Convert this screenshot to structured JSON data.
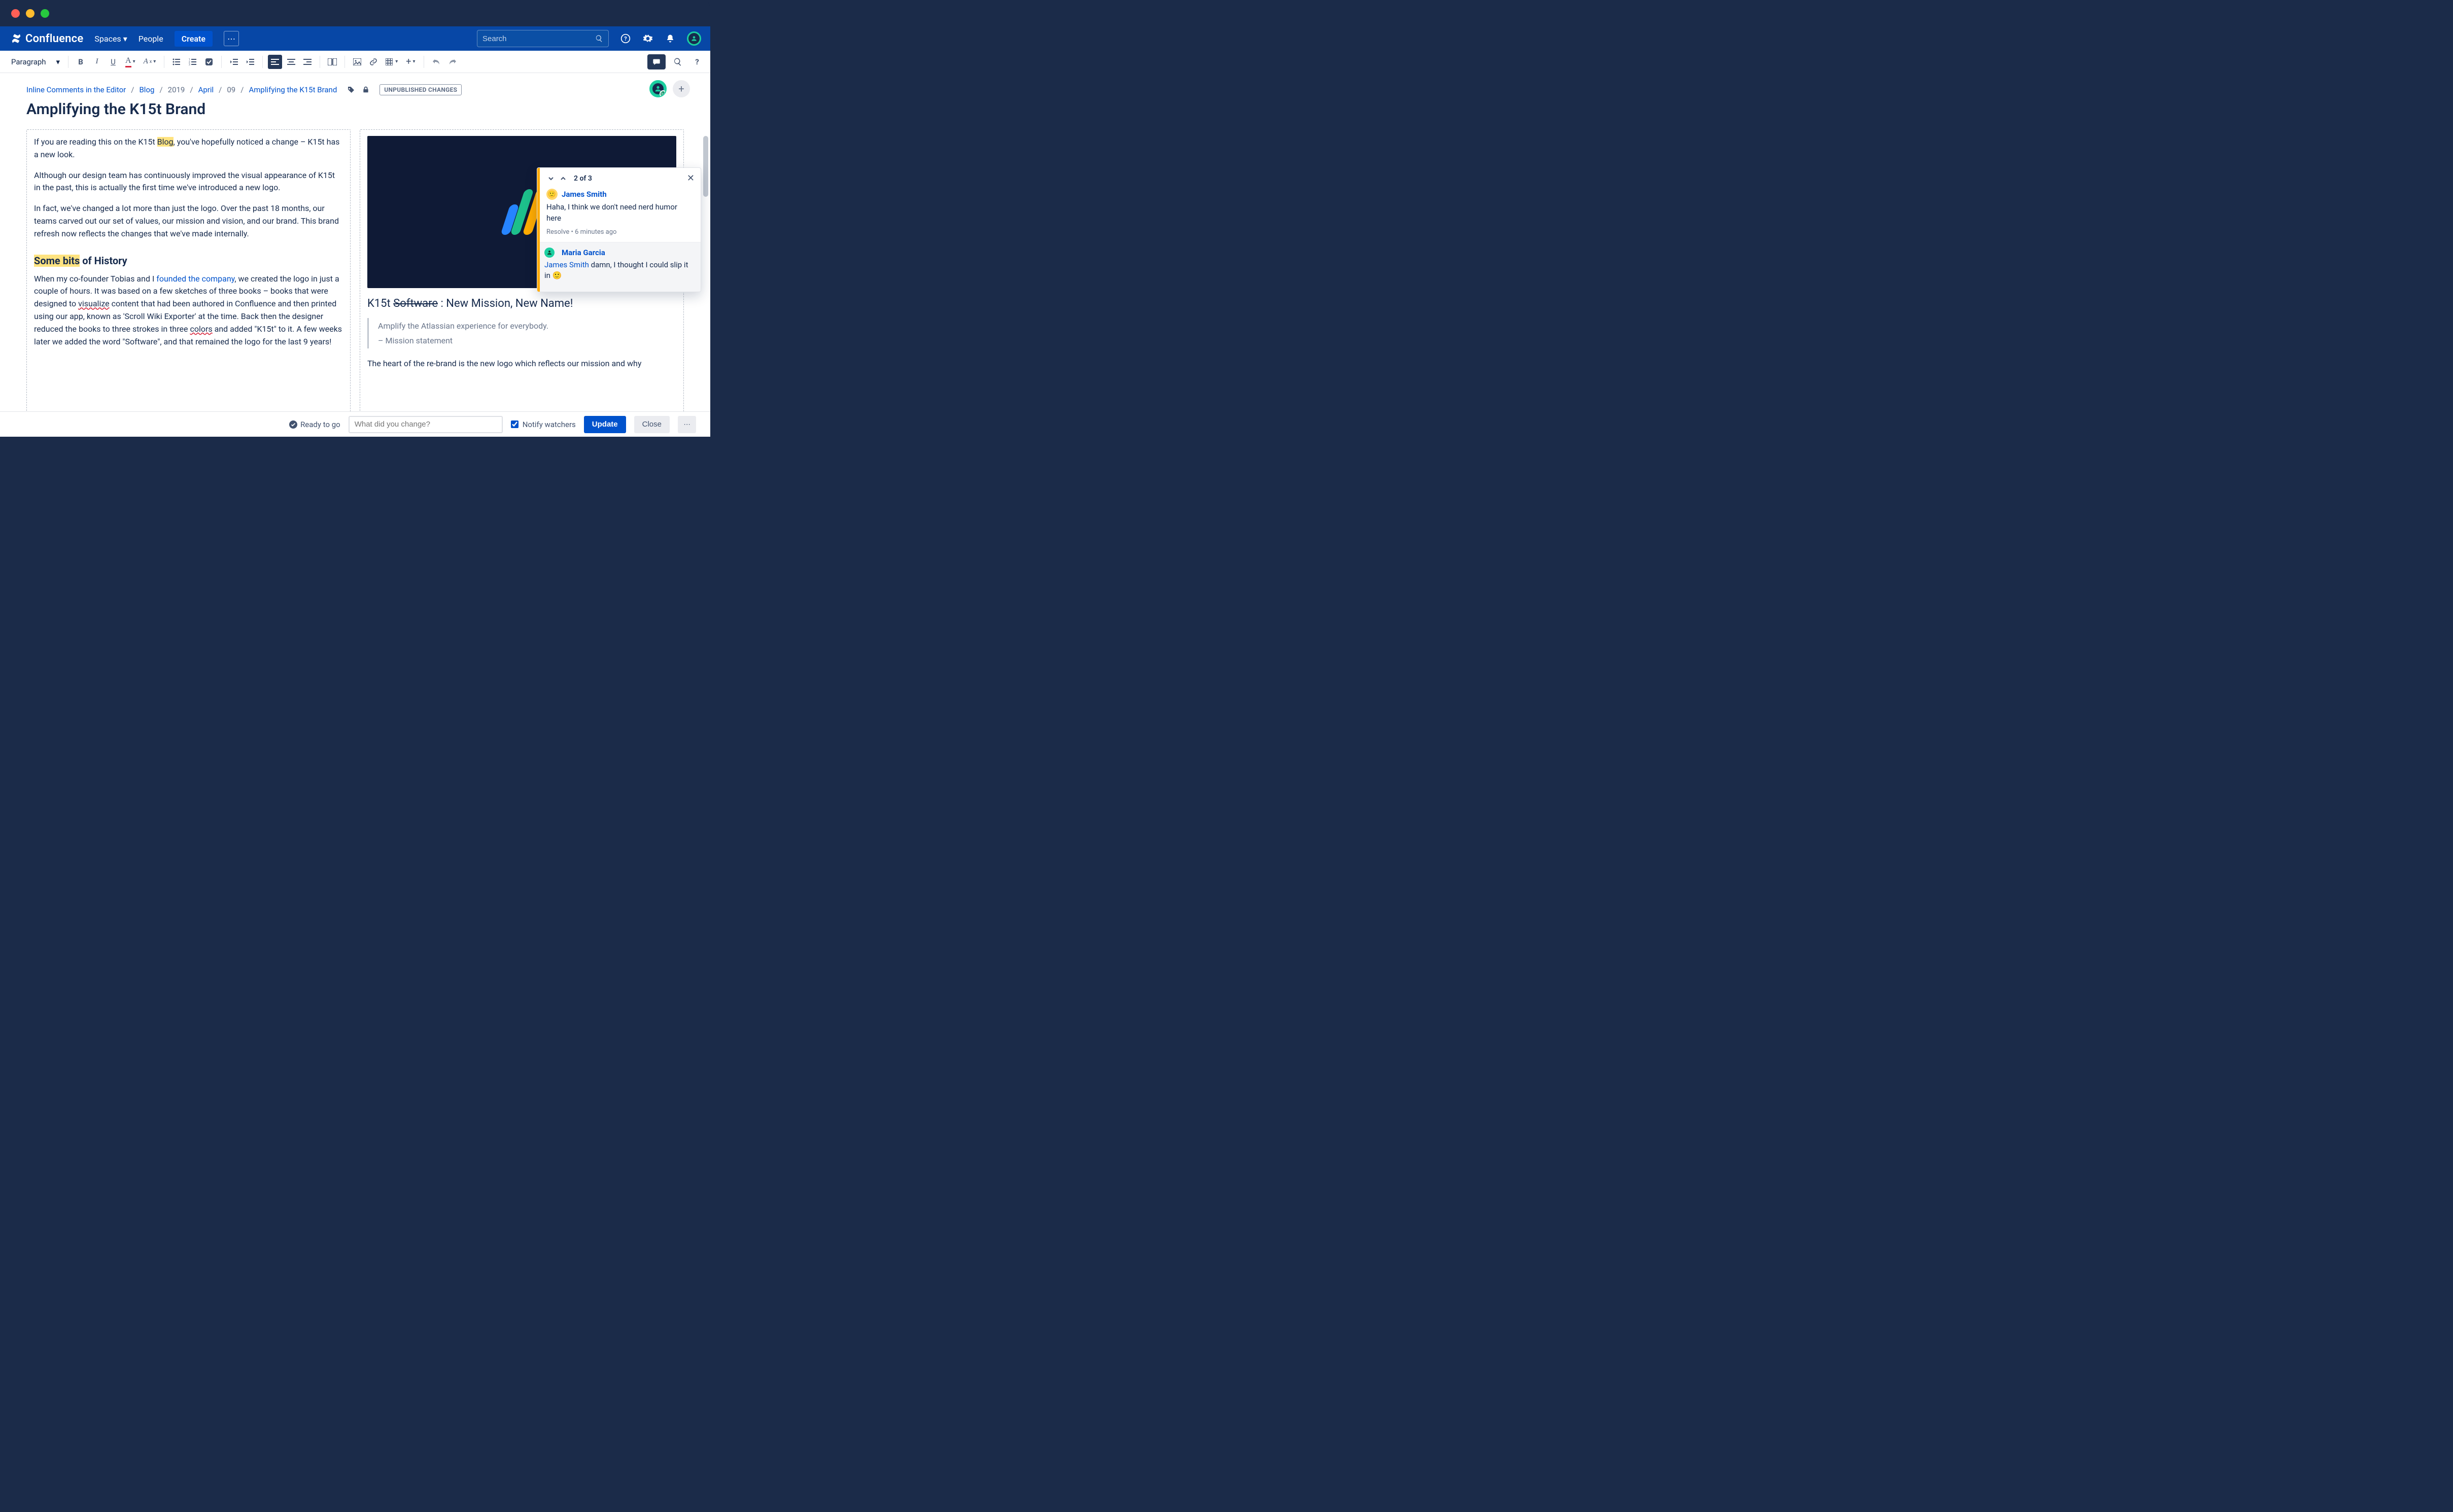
{
  "nav": {
    "product": "Confluence",
    "spaces": "Spaces",
    "people": "People",
    "create": "Create",
    "search_placeholder": "Search"
  },
  "toolbar": {
    "style_label": "Paragraph"
  },
  "breadcrumb": {
    "root": "Inline Comments in the Editor",
    "blog": "Blog",
    "year": "2019",
    "month": "April",
    "day": "09",
    "page": "Amplifying the K15t Brand",
    "badge": "UNPUBLISHED CHANGES"
  },
  "title": "Amplifying the K15t Brand",
  "left": {
    "p1a": "If you are reading this on the K15t ",
    "hl1": "Blog",
    "p1b": ", you've hopefully noticed a change – K15t has a new look.",
    "p2": "Although our design team has continuously improved the visual appearance of K15t in the past, this is actually the first time we've introduced a new logo.",
    "p3": "In fact, we've changed a lot more than just the logo. Over the past 18 months, our teams carved out our set of values, our mission and vision, and our brand. This brand refresh now reflects the changes that we've made internally.",
    "h2_hl": "Some bits",
    "h2_rest": " of History",
    "p4a": "When my co-founder Tobias and I ",
    "link": "founded the company",
    "p4b": ", we created the logo in just a couple of hours. It was based on a few sketches of three books – books that were designed to ",
    "sp1": "visualize",
    "p4c": " content that had been authored in Confluence and then printed using our app, known as 'Scroll Wiki Exporter' at the time. Back then the designer reduced the books to three strokes in three ",
    "sp2": "colors",
    "p4d": " and added \"K15t\" to it. A few weeks later we added the word \"Software\", and that remained the logo for the last 9 years!"
  },
  "right": {
    "h_pre": "K15t ",
    "h_strike": "Software",
    "h_post": " : New Mission, New Name!",
    "q1": "Amplify the Atlassian experience for everybody.",
    "q2": "– Mission statement",
    "p": "The heart of the re-brand is the new logo which reflects our mission and why"
  },
  "comments": {
    "count": "2 of 3",
    "c1_author": "James Smith",
    "c1_text": "Haha, I think we don't need nerd humor here",
    "c1_resolve": "Resolve",
    "c1_time": "6 minutes ago",
    "c2_author": "Maria Garcia",
    "c2_mention": "James Smith",
    "c2_text": " damn, I thought I could slip it in 🙂"
  },
  "footer": {
    "ready": "Ready to go",
    "change_placeholder": "What did you change?",
    "notify": "Notify watchers",
    "update": "Update",
    "close": "Close"
  }
}
